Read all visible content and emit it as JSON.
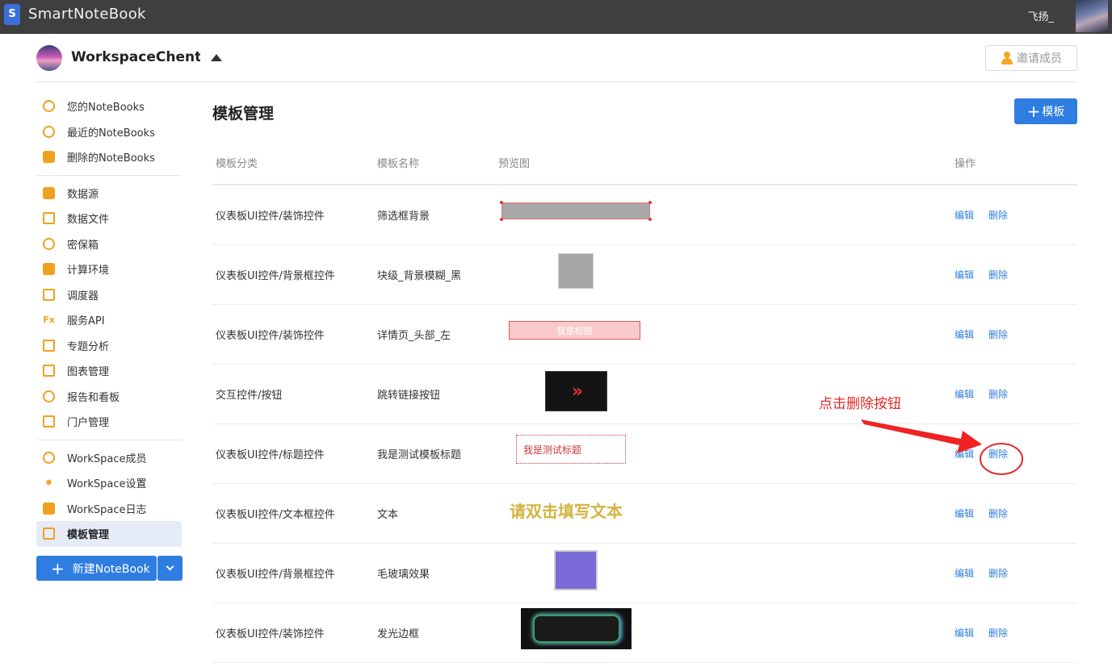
{
  "app": {
    "title": "SmartNoteBook",
    "logo_text": "S",
    "user_name": "飞扬_"
  },
  "workspace": {
    "name": "WorkspaceChentao",
    "invite_label": "邀请成员"
  },
  "sidebar": {
    "groups": [
      [
        {
          "label": "您的NoteBooks",
          "icon": "notebook-icon"
        },
        {
          "label": "最近的NoteBooks",
          "icon": "clock-icon"
        },
        {
          "label": "删除的NoteBooks",
          "icon": "trash-icon"
        }
      ],
      [
        {
          "label": "数据源",
          "icon": "database-icon"
        },
        {
          "label": "数据文件",
          "icon": "file-icon"
        },
        {
          "label": "密保箱",
          "icon": "shield-icon"
        },
        {
          "label": "计算环境",
          "icon": "compute-icon"
        },
        {
          "label": "调度器",
          "icon": "calendar-icon"
        },
        {
          "label": "服务API",
          "icon": "function-icon"
        },
        {
          "label": "专题分析",
          "icon": "presentation-icon"
        },
        {
          "label": "图表管理",
          "icon": "chart-icon"
        },
        {
          "label": "报告和看板",
          "icon": "dashboard-icon"
        },
        {
          "label": "门户管理",
          "icon": "monitor-icon"
        }
      ],
      [
        {
          "label": "WorkSpace成员",
          "icon": "user-icon"
        },
        {
          "label": "WorkSpace设置",
          "icon": "gear-icon"
        },
        {
          "label": "WorkSpace日志",
          "icon": "log-icon"
        },
        {
          "label": "模板管理",
          "icon": "template-icon",
          "active": true
        }
      ]
    ],
    "new_notebook_label": "新建NoteBook"
  },
  "main": {
    "title": "模板管理",
    "add_label": "模板",
    "columns": {
      "category": "模板分类",
      "name": "模板名称",
      "preview": "预览图",
      "actions": "操作"
    },
    "edit_label": "编辑",
    "delete_label": "删除",
    "rows": [
      {
        "category": "仪表板UI控件/装饰控件",
        "name": "筛选框背景",
        "preview": "filter-bg"
      },
      {
        "category": "仪表板UI控件/背景框控件",
        "name": "块级_背景模糊_黑",
        "preview": "block-blur"
      },
      {
        "category": "仪表板UI控件/装饰控件",
        "name": "详情页_头部_左",
        "preview": "detail-header",
        "preview_text": "我是标题"
      },
      {
        "category": "交互控件/按钮",
        "name": "跳转链接按钮",
        "preview": "link-button",
        "preview_text": "»"
      },
      {
        "category": "仪表板UI控件/标题控件",
        "name": "我是测试模板标题",
        "preview": "test-title",
        "preview_text": "我是测试标题"
      },
      {
        "category": "仪表板UI控件/文本框控件",
        "name": "文本",
        "preview": "text-box",
        "preview_text": "请双击填写文本"
      },
      {
        "category": "仪表板UI控件/背景框控件",
        "name": "毛玻璃效果",
        "preview": "frosted-glass"
      },
      {
        "category": "仪表板UI控件/装饰控件",
        "name": "发光边框",
        "preview": "glow-border"
      }
    ]
  },
  "annotation": {
    "text": "点击删除按钮",
    "color": "#e02a2a"
  },
  "colors": {
    "accent": "#2f7de1",
    "topbar": "#3f3f3f",
    "icon": "#f0a020"
  }
}
